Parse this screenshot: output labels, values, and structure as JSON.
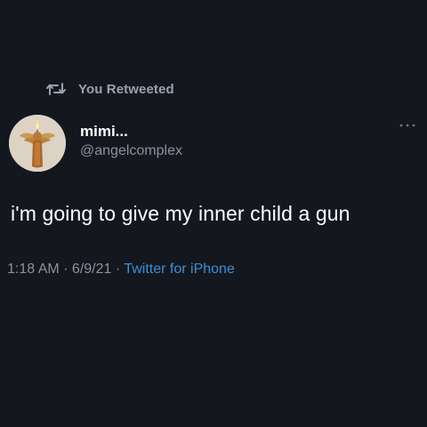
{
  "retweet": {
    "icon": "retweet-icon",
    "label": "You Retweeted"
  },
  "author": {
    "name": "mimi...",
    "handle": "@angelcomplex",
    "avatar_icon": "candle-angel-avatar"
  },
  "more_icon": "more-dots-icon",
  "tweet": {
    "text": "i'm going to give my inner child a gun"
  },
  "meta": {
    "time": "1:18 AM",
    "separator": " · ",
    "date": "6/9/21",
    "source": "Twitter for iPhone"
  },
  "colors": {
    "background": "#14171e",
    "text_primary": "#ffffff",
    "text_secondary": "#8b929c",
    "link": "#3d8fd6"
  }
}
